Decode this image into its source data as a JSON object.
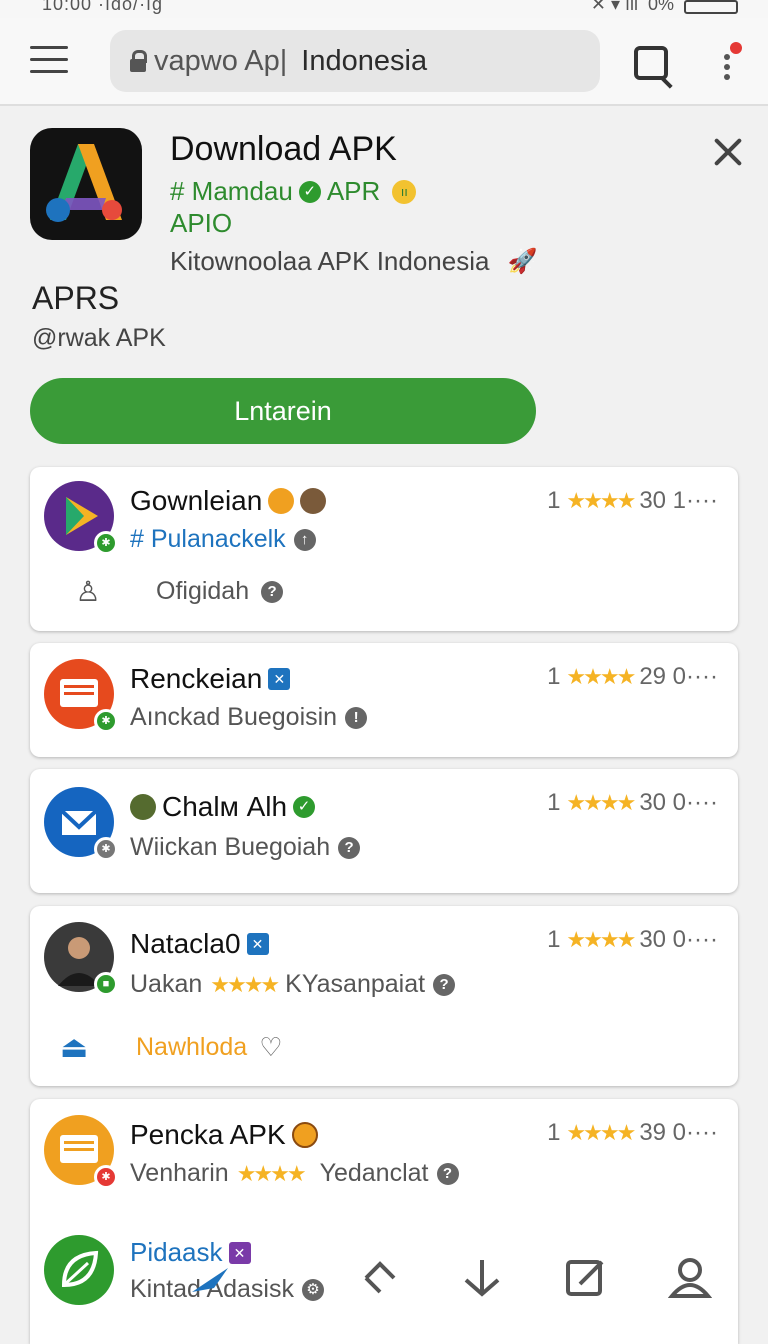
{
  "status_bar": {
    "time": "10:00 ·ıdo/·ıg",
    "battery": "0%"
  },
  "browser": {
    "url_prefix": "vapwo Ap|",
    "url_host": "Indonesia"
  },
  "header": {
    "title": "Download APK",
    "subtitle": "# Mamdau",
    "subtitle_tag": "APR",
    "subtitle2": "APIO",
    "description": "Kitownoolaa APK Indonesia",
    "app_name": "APRS",
    "developer": "@rwak APK",
    "install_label": "Lntarein"
  },
  "cards": [
    {
      "title": "Gownleian",
      "subtitle": "# Pulanackelk",
      "rating_prefix": "1",
      "stars": "★★★★",
      "rating_suffix": "30 1····",
      "action": "Ofigidah"
    },
    {
      "title": "Renckeian",
      "subtitle": "Aınckad Buegoisin",
      "rating_prefix": "1",
      "stars": "★★★★",
      "rating_suffix": "29 0····"
    },
    {
      "title": "Chalм Alh",
      "subtitle": "Wiickan Buegoiah",
      "rating_prefix": "1",
      "stars": "★★★★",
      "rating_suffix": "30 0····"
    },
    {
      "title": "Natacla0",
      "subtitle_pre": "Uakan",
      "subtitle_stars": "★★★★",
      "subtitle_post": "KYasanpaiat",
      "rating_prefix": "1",
      "stars": "★★★★",
      "rating_suffix": "30 0····",
      "action": "Nawhloda"
    },
    {
      "title": "Pencka APK",
      "subtitle_pre": "Venharin",
      "subtitle_stars": "★★★★",
      "subtitle_post": "Yedanclat",
      "rating_prefix": "1",
      "stars": "★★★★",
      "rating_suffix": "39 0····",
      "link_title": "Pidaask",
      "link_sub": "Kintad Adasisk"
    }
  ],
  "bottom_nav": [
    "share-icon",
    "download-icon",
    "edit-icon",
    "profile-icon"
  ],
  "colors": {
    "primary_green": "#3a9b38",
    "link_blue": "#1e73be",
    "star": "#f5b324",
    "accent_orange": "#f0a020"
  }
}
